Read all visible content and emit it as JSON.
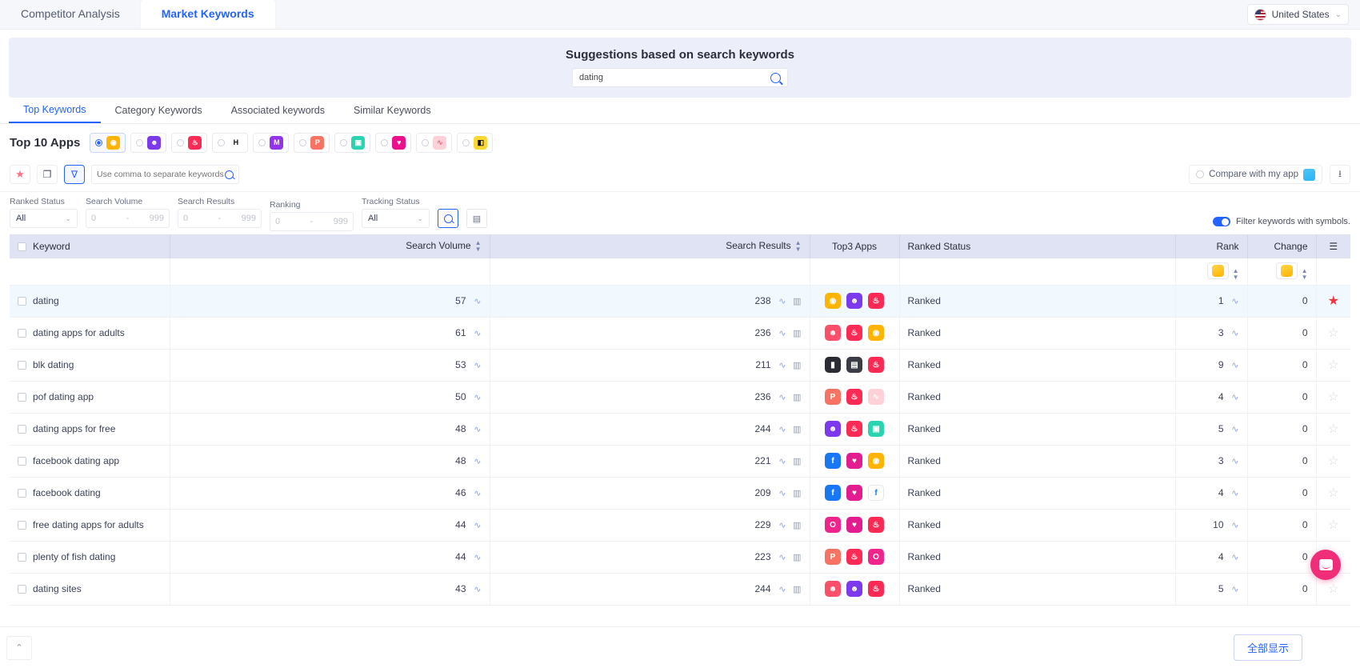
{
  "header": {
    "tabs": [
      {
        "label": "Competitor Analysis",
        "active": false
      },
      {
        "label": "Market Keywords",
        "active": true
      }
    ],
    "country": {
      "label": "United States",
      "icon": "us-flag-icon",
      "caret": "⌄"
    }
  },
  "suggest": {
    "title": "Suggestions based on search keywords",
    "input_value": "dating",
    "placeholder": "",
    "search_icon": "search-icon"
  },
  "subtabs": [
    {
      "label": "Top Keywords",
      "active": true
    },
    {
      "label": "Category Keywords",
      "active": false
    },
    {
      "label": "Associated keywords",
      "active": false
    },
    {
      "label": "Similar Keywords",
      "active": false
    }
  ],
  "top10": {
    "label": "Top 10 Apps",
    "apps": [
      {
        "name": "bumble",
        "glyph": "◉",
        "color": "#ffb400",
        "selected": true
      },
      {
        "name": "app-purple-smiley",
        "glyph": "☻",
        "color": "#7c3aed",
        "selected": false
      },
      {
        "name": "tinder",
        "glyph": "♨",
        "color": "#fd2a55",
        "selected": false
      },
      {
        "name": "hinge",
        "glyph": "H",
        "color": "#ffffff",
        "text_color": "#111111",
        "selected": false
      },
      {
        "name": "app-violet",
        "glyph": "M",
        "color": "#9333ea",
        "selected": false
      },
      {
        "name": "plenty-of-fish",
        "glyph": "P",
        "color": "#f97362",
        "selected": false
      },
      {
        "name": "app-teal",
        "glyph": "▣",
        "color": "#2ad4b0",
        "selected": false
      },
      {
        "name": "app-magenta",
        "glyph": "♥",
        "color": "#ec0f8b",
        "selected": false
      },
      {
        "name": "app-pink-light",
        "glyph": "∿",
        "color": "#ffd0d8",
        "text_color": "#f0607e",
        "selected": false
      },
      {
        "name": "app-yellow-black",
        "glyph": "◧",
        "color": "#fdd835",
        "text_color": "#111111",
        "selected": false
      }
    ]
  },
  "toolbar": {
    "star_icon": "star-icon",
    "copy_icon": "copy-icon",
    "filter_icon": "funnel-icon",
    "keyword_placeholder": "Use comma to separate keywords",
    "keyword_value": "",
    "search_icon": "search-icon",
    "compare_label": "Compare with my app",
    "download_icon": "download-icon"
  },
  "filters": {
    "ranked_status": {
      "label": "Ranked Status",
      "value": "All"
    },
    "search_volume": {
      "label": "Search Volume",
      "min": "0",
      "dash": "-",
      "max": "999"
    },
    "search_results": {
      "label": "Search Results",
      "min": "0",
      "dash": "-",
      "max": "999"
    },
    "ranking": {
      "label": "Ranking",
      "min": "0",
      "dash": "-",
      "max": "999"
    },
    "tracking_status": {
      "label": "Tracking Status",
      "value": "All"
    },
    "search_button_icon": "search-icon",
    "save_button_icon": "briefcase-icon",
    "symbols_toggle": {
      "label": "Filter keywords with symbols.",
      "on": true,
      "color": "#2563ff"
    }
  },
  "table": {
    "columns": [
      {
        "key": "keyword",
        "label": "Keyword",
        "sortable": false
      },
      {
        "key": "search_volume",
        "label": "Search Volume",
        "sortable": true
      },
      {
        "key": "search_results",
        "label": "Search Results",
        "sortable": true
      },
      {
        "key": "top3",
        "label": "Top3 Apps",
        "sortable": false
      },
      {
        "key": "ranked_status",
        "label": "Ranked Status",
        "sortable": false
      },
      {
        "key": "rank",
        "label": "Rank",
        "sortable": false
      },
      {
        "key": "change",
        "label": "Change",
        "sortable": false
      },
      {
        "key": "menu",
        "label": "☰",
        "sortable": false
      }
    ],
    "subheader": {
      "rank_chip_icon": "bumble-app-icon",
      "change_chip_icon": "bumble-app-icon",
      "sort_glyph": "⇅"
    },
    "rows": [
      {
        "keyword": "dating",
        "search_volume": "57",
        "search_results": "238",
        "ranked_status": "Ranked",
        "rank": "1",
        "change": "0",
        "starred": true,
        "highlight": true,
        "top3": [
          {
            "name": "bumble",
            "glyph": "◉",
            "color": "#ffb400"
          },
          {
            "name": "app-purple-smiley",
            "glyph": "☻",
            "color": "#7c3aed"
          },
          {
            "name": "tinder",
            "glyph": "♨",
            "color": "#fd2a55"
          }
        ]
      },
      {
        "keyword": "dating apps for adults",
        "search_volume": "61",
        "search_results": "236",
        "ranked_status": "Ranked",
        "rank": "3",
        "change": "0",
        "starred": false,
        "highlight": false,
        "top3": [
          {
            "name": "app-red-chat",
            "glyph": "☻",
            "color": "#fb4f6b"
          },
          {
            "name": "tinder",
            "glyph": "♨",
            "color": "#fd2a55"
          },
          {
            "name": "bumble",
            "glyph": "◉",
            "color": "#ffb400"
          }
        ]
      },
      {
        "keyword": "blk dating",
        "search_volume": "53",
        "search_results": "211",
        "ranked_status": "Ranked",
        "rank": "9",
        "change": "0",
        "starred": false,
        "highlight": false,
        "top3": [
          {
            "name": "app-dark",
            "glyph": "▮",
            "color": "#2b2b33"
          },
          {
            "name": "app-dark-two",
            "glyph": "▤",
            "color": "#3b3b45"
          },
          {
            "name": "tinder",
            "glyph": "♨",
            "color": "#fd2a55"
          }
        ]
      },
      {
        "keyword": "pof dating app",
        "search_volume": "50",
        "search_results": "236",
        "ranked_status": "Ranked",
        "rank": "4",
        "change": "0",
        "starred": false,
        "highlight": false,
        "top3": [
          {
            "name": "plenty-of-fish",
            "glyph": "P",
            "color": "#f97362"
          },
          {
            "name": "tinder",
            "glyph": "♨",
            "color": "#fd2a55"
          },
          {
            "name": "app-pink-light",
            "glyph": "∿",
            "color": "#ffd0d8"
          }
        ]
      },
      {
        "keyword": "dating apps for free",
        "search_volume": "48",
        "search_results": "244",
        "ranked_status": "Ranked",
        "rank": "5",
        "change": "0",
        "starred": false,
        "highlight": false,
        "top3": [
          {
            "name": "app-purple-smiley",
            "glyph": "☻",
            "color": "#7c3aed"
          },
          {
            "name": "tinder",
            "glyph": "♨",
            "color": "#fd2a55"
          },
          {
            "name": "app-teal",
            "glyph": "▣",
            "color": "#2ad4b0"
          }
        ]
      },
      {
        "keyword": "facebook dating app",
        "search_volume": "48",
        "search_results": "221",
        "ranked_status": "Ranked",
        "rank": "3",
        "change": "0",
        "starred": false,
        "highlight": false,
        "top3": [
          {
            "name": "facebook",
            "glyph": "f",
            "color": "#1877f2"
          },
          {
            "name": "app-magenta-heart",
            "glyph": "♥",
            "color": "#e11d8f"
          },
          {
            "name": "bumble",
            "glyph": "◉",
            "color": "#ffb400"
          }
        ]
      },
      {
        "keyword": "facebook dating",
        "search_volume": "46",
        "search_results": "209",
        "ranked_status": "Ranked",
        "rank": "4",
        "change": "0",
        "starred": false,
        "highlight": false,
        "top3": [
          {
            "name": "facebook",
            "glyph": "f",
            "color": "#1877f2"
          },
          {
            "name": "app-magenta-heart",
            "glyph": "♥",
            "color": "#e11d8f"
          },
          {
            "name": "facebook-white",
            "glyph": "f",
            "color": "#ffffff"
          }
        ]
      },
      {
        "keyword": "free dating apps for adults",
        "search_volume": "44",
        "search_results": "229",
        "ranked_status": "Ranked",
        "rank": "10",
        "change": "0",
        "starred": false,
        "highlight": false,
        "top3": [
          {
            "name": "app-pink-o",
            "glyph": "O",
            "color": "#f0258c"
          },
          {
            "name": "app-magenta-heart",
            "glyph": "♥",
            "color": "#e11d8f"
          },
          {
            "name": "tinder",
            "glyph": "♨",
            "color": "#fd2a55"
          }
        ]
      },
      {
        "keyword": "plenty of fish dating",
        "search_volume": "44",
        "search_results": "223",
        "ranked_status": "Ranked",
        "rank": "4",
        "change": "0",
        "starred": false,
        "highlight": false,
        "top3": [
          {
            "name": "plenty-of-fish",
            "glyph": "P",
            "color": "#f97362"
          },
          {
            "name": "tinder",
            "glyph": "♨",
            "color": "#fd2a55"
          },
          {
            "name": "app-pink-o",
            "glyph": "O",
            "color": "#f0258c"
          }
        ]
      },
      {
        "keyword": "dating sites",
        "search_volume": "43",
        "search_results": "244",
        "ranked_status": "Ranked",
        "rank": "5",
        "change": "0",
        "starred": false,
        "highlight": false,
        "top3": [
          {
            "name": "app-red-chat",
            "glyph": "☻",
            "color": "#fb4f6b"
          },
          {
            "name": "app-purple-smiley",
            "glyph": "☻",
            "color": "#7c3aed"
          },
          {
            "name": "tinder",
            "glyph": "♨",
            "color": "#fd2a55"
          }
        ]
      }
    ]
  },
  "bottom": {
    "scroll_top_icon": "chevron-up-icon",
    "show_all_label": "全部显示",
    "chat_icon": "chat-bubble-icon"
  }
}
